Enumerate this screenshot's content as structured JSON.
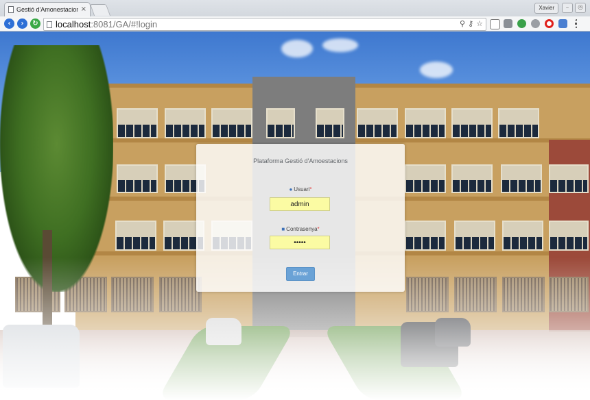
{
  "browser": {
    "tab_title": "Gestió d'Amonestacions E",
    "tab_close": "×",
    "user_badge": "Xavier",
    "url_host": "localhost",
    "url_rest": ":8081/GA/#!login"
  },
  "login": {
    "title": "Plataforma Gestió d'Amoestacions",
    "username_label": "Usuari",
    "username_value": "admin",
    "password_label": "Contrasenya",
    "password_value": "•••••",
    "required_marker": "*",
    "submit_label": "Entrar"
  },
  "colors": {
    "input_background": "#fbfba3",
    "button": "#6aa2d6",
    "required": "#e23b3b"
  }
}
